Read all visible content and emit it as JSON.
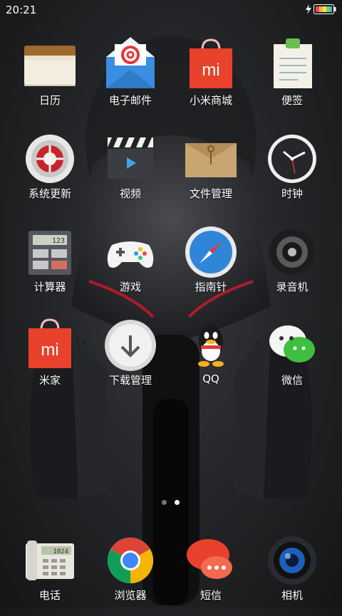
{
  "status_bar": {
    "time": "20:21",
    "battery_icon": "battery-icon",
    "charging_icon": "charging-bolt-icon"
  },
  "home": {
    "apps": [
      {
        "label": "日历",
        "icon": "calendar-icon"
      },
      {
        "label": "电子邮件",
        "icon": "email-icon"
      },
      {
        "label": "小米商城",
        "icon": "mi-store-icon"
      },
      {
        "label": "便签",
        "icon": "notes-icon"
      },
      {
        "label": "系统更新",
        "icon": "system-update-icon"
      },
      {
        "label": "视频",
        "icon": "video-icon"
      },
      {
        "label": "文件管理",
        "icon": "file-manager-icon"
      },
      {
        "label": "时钟",
        "icon": "clock-icon"
      },
      {
        "label": "计算器",
        "icon": "calculator-icon"
      },
      {
        "label": "游戏",
        "icon": "gamepad-icon"
      },
      {
        "label": "指南针",
        "icon": "compass-icon"
      },
      {
        "label": "录音机",
        "icon": "recorder-icon"
      },
      {
        "label": "米家",
        "icon": "mijia-icon"
      },
      {
        "label": "下载管理",
        "icon": "download-icon"
      },
      {
        "label": "QQ",
        "icon": "qq-penguin-icon"
      },
      {
        "label": "微信",
        "icon": "wechat-icon"
      }
    ],
    "page_indicator": {
      "total": 2,
      "current": 2
    }
  },
  "dock": {
    "apps": [
      {
        "label": "电话",
        "icon": "phone-icon",
        "display": "1024"
      },
      {
        "label": "浏览器",
        "icon": "browser-icon"
      },
      {
        "label": "短信",
        "icon": "messages-icon"
      },
      {
        "label": "相机",
        "icon": "camera-icon"
      }
    ]
  },
  "calculator_display": "123",
  "colors": {
    "mi_red": "#e8412c",
    "wechat_green": "#3fbf3f",
    "accent_blue": "#2f86d8"
  }
}
